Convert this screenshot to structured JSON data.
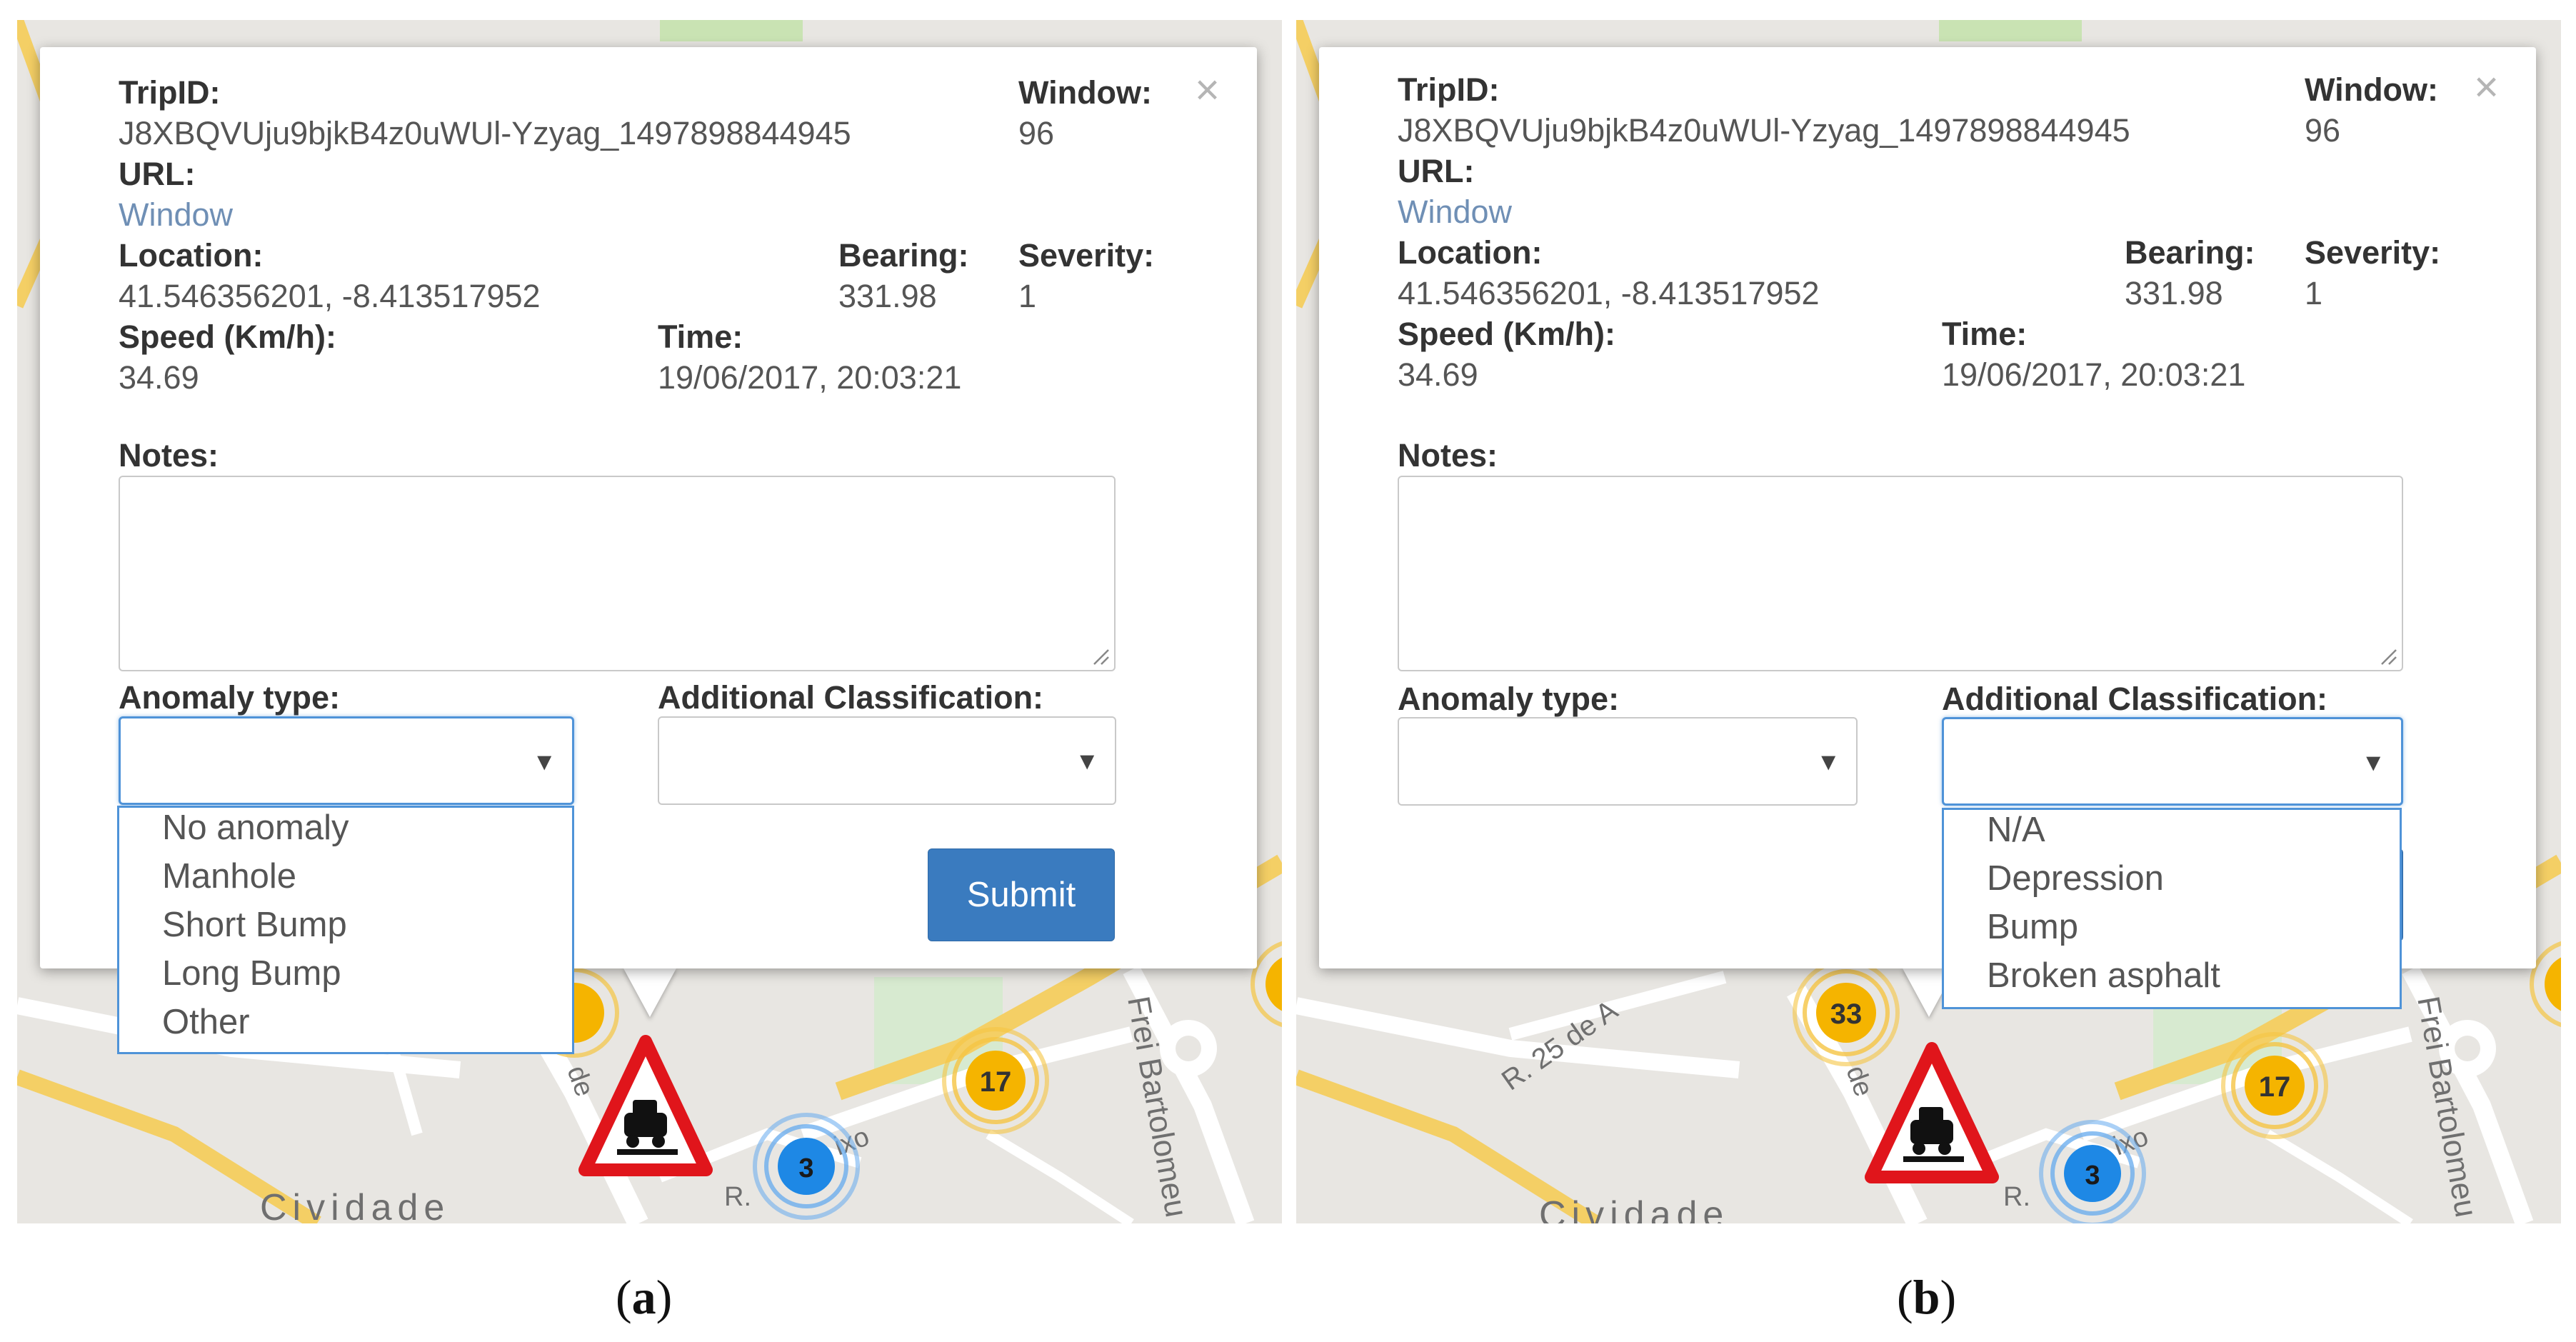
{
  "popup": {
    "tripid_label": "TripID:",
    "tripid_value": "J8XBQVUju9bjkB4z0uWUl-Yzyag_1497898844945",
    "url_label": "URL:",
    "url_link": "Window",
    "window_label": "Window:",
    "window_value": "96",
    "close_symbol": "×",
    "location_label": "Location:",
    "location_value": "41.546356201, -8.413517952",
    "bearing_label": "Bearing:",
    "bearing_value": "331.98",
    "severity_label": "Severity:",
    "severity_value": "1",
    "speed_label": "Speed (Km/h):",
    "speed_value": "34.69",
    "time_label": "Time:",
    "time_value": "19/06/2017, 20:03:21",
    "notes_label": "Notes:",
    "anomaly_label": "Anomaly type:",
    "classification_label": "Additional Classification:",
    "caret": "▼",
    "submit_label": "Submit"
  },
  "dropdown_a": {
    "options": [
      "No anomaly",
      "Manhole",
      "Short Bump",
      "Long Bump",
      "Other"
    ]
  },
  "dropdown_b": {
    "options": [
      "N/A",
      "Depression",
      "Bump",
      "Broken asphalt"
    ]
  },
  "map": {
    "district": "Cividade",
    "street_left": "Frei Bartolomeu",
    "street_r25": "R. 25 de A",
    "street_de": "de",
    "street_ixo": "ixo",
    "cluster_yellow_a": "17",
    "cluster_blue": "3",
    "cluster_yellow_b1": "33",
    "cluster_yellow_b2": "17",
    "road_partial": "R."
  },
  "captions": {
    "a": "a",
    "b": "b"
  },
  "colors": {
    "accent": "#3a7bbf",
    "focus": "#4f93d8",
    "cluster_yellow": "#f5b400",
    "cluster_blue": "#1e88e5",
    "warning_red": "#e0151b"
  },
  "icons": [
    "close-icon",
    "caret-down-icon",
    "road-warning-icon",
    "cluster-icon"
  ]
}
